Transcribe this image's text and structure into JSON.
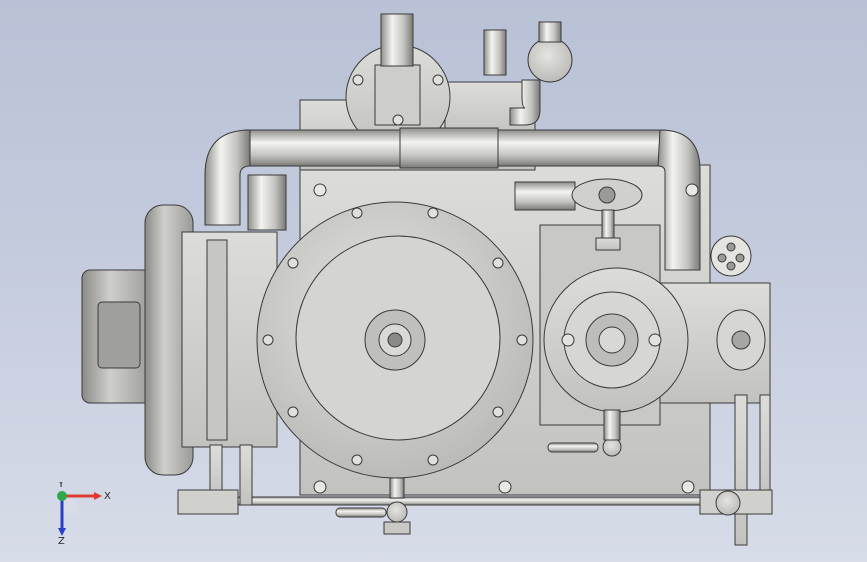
{
  "viewport": {
    "background_top": "#b9c1d6",
    "background_bottom": "#d7dce8",
    "model_color": "#cfcfcb",
    "edge_color": "#3a3a3a"
  },
  "triad": {
    "x_label": "X",
    "y_label": "Y",
    "z_label": "Z",
    "x_color": "#e03a2f",
    "y_color": "#2fa84a",
    "z_color": "#2a3fc9"
  }
}
